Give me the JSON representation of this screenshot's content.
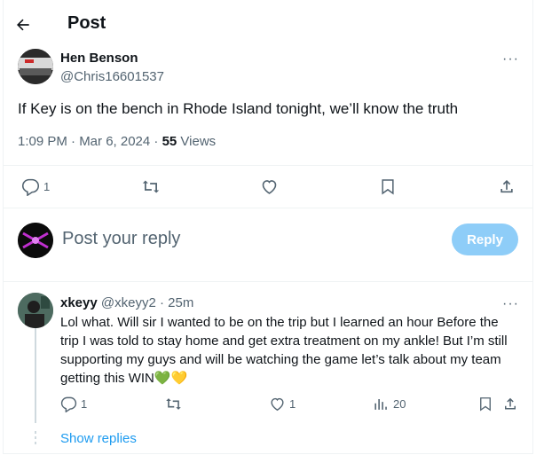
{
  "header": {
    "title": "Post"
  },
  "post": {
    "author_name": "Hen Benson",
    "author_handle": "@Chris16601537",
    "text": "If Key is on the bench in Rhode Island tonight, we’ll know the truth",
    "timestamp": "1:09 PM · Mar 6, 2024 · ",
    "views_count": "55",
    "views_label": " Views",
    "actions": {
      "replies": "1"
    },
    "more_label": "···"
  },
  "composer": {
    "placeholder": "Post your reply",
    "reply_label": "Reply"
  },
  "reply": {
    "author_name": "xkeyy",
    "author_handle": "@xkeyy2",
    "time": "· 25m",
    "text": "Lol what. Will sir I wanted to be on the trip but I learned an hour Before the trip I was told to stay home and get extra treatment on my ankle! But I’m still supporting my guys and will be watching the game let’s talk about my team getting this WIN💚💛",
    "actions": {
      "replies": "1",
      "likes": "1",
      "views": "20"
    },
    "more_label": "···"
  },
  "show_replies": "Show replies",
  "icons": [
    "back-arrow-icon",
    "reply-icon",
    "repost-icon",
    "like-icon",
    "bookmark-icon",
    "share-icon",
    "views-icon",
    "more-icon"
  ]
}
